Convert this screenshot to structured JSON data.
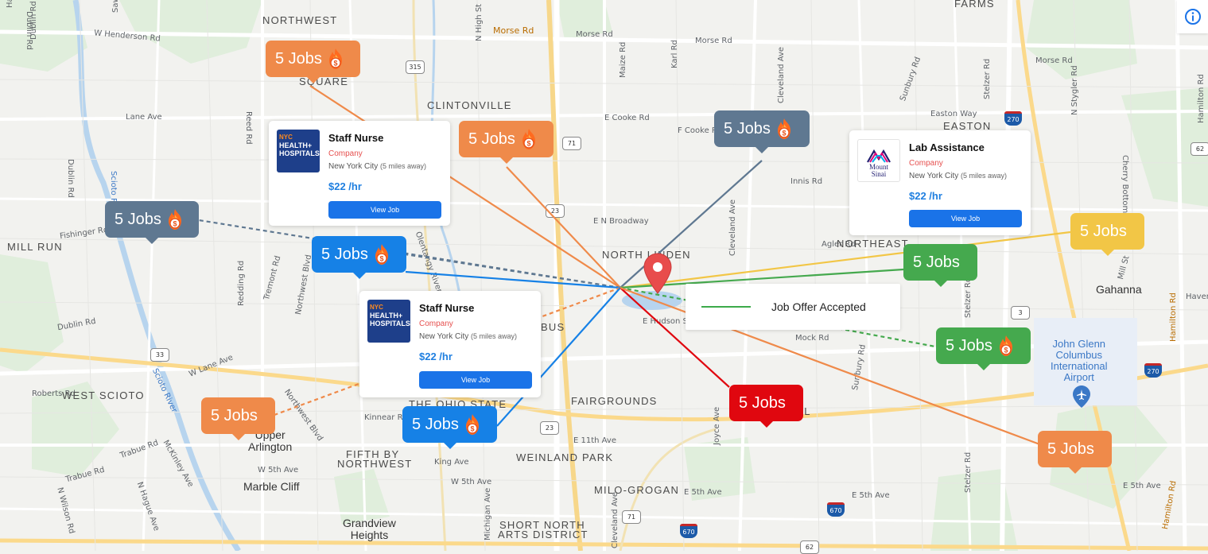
{
  "colors": {
    "orange": "#ef8a4a",
    "slate": "#5f7891",
    "blue": "#1681e6",
    "yellow": "#f2c646",
    "green": "#45a94e",
    "red": "#e0070f",
    "pin": "#e84c4c"
  },
  "bubble_text": "5 Jobs",
  "bubbles": [
    {
      "id": "b1",
      "text": "5 Jobs",
      "color": "orange",
      "fire": true
    },
    {
      "id": "b2",
      "text": "5 Jobs",
      "color": "orange",
      "fire": true
    },
    {
      "id": "b3",
      "text": "5 Jobs",
      "color": "slate",
      "fire": true
    },
    {
      "id": "b4",
      "text": "5 Jobs",
      "color": "slate",
      "fire": true
    },
    {
      "id": "b5",
      "text": "5 Jobs",
      "color": "blue",
      "fire": true
    },
    {
      "id": "b6",
      "text": "5 Jobs",
      "color": "yellow",
      "fire": false
    },
    {
      "id": "b7",
      "text": "5 Jobs",
      "color": "green",
      "fire": false
    },
    {
      "id": "b8",
      "text": "5 Jobs",
      "color": "green",
      "fire": true
    },
    {
      "id": "b9",
      "text": "5 Jobs",
      "color": "orange",
      "fire": false
    },
    {
      "id": "b10",
      "text": "5 Jobs",
      "color": "blue",
      "fire": true
    },
    {
      "id": "b11",
      "text": "5 Jobs",
      "color": "red",
      "fire": false
    },
    {
      "id": "b12",
      "text": "5 Jobs",
      "color": "orange",
      "fire": false
    }
  ],
  "cards": [
    {
      "title": "Staff Nurse",
      "company": "Company",
      "location": "New York City",
      "distance": "(5 miles away)",
      "rate": "$22 /hr",
      "button": "View Job",
      "logo_line1": "NYC",
      "logo_line2": "HEALTH+",
      "logo_line3": "HOSPITALS",
      "logo": "nyc-health-hospitals"
    },
    {
      "title": "Staff Nurse",
      "company": "Company",
      "location": "New York City",
      "distance": "(5 miles away)",
      "rate": "$22 /hr",
      "button": "View Job",
      "logo_line1": "NYC",
      "logo_line2": "HEALTH+",
      "logo_line3": "HOSPITALS",
      "logo": "nyc-health-hospitals"
    },
    {
      "title": "Lab Assistance",
      "company": "Company",
      "location": "New York City",
      "distance": "(5 miles away)",
      "rate": "$22 /hr",
      "button": "View Job",
      "logo_line1": "Mount",
      "logo_line2": "Sinai",
      "logo": "mount-sinai"
    }
  ],
  "legend": {
    "label": "Job Offer Accepted",
    "line_color": "#3daa4a"
  },
  "map_labels": {
    "areas": [
      "NORTHWEST",
      "CLINTONVILLE",
      "EASTON",
      "NORTHEAST",
      "FARMS",
      "MILL RUN",
      "NORTH LINDEN",
      "WEST SCIOTO",
      "FAIRGROUNDS",
      "THE OHIO STATE",
      "FIFTH BY",
      "NORTHWEST",
      "WEINLAND PARK",
      "MILO-GROGAN",
      "SHORT NORTH",
      "ARTS DISTRICT",
      "SQUARE",
      "BUS",
      "NIAL"
    ],
    "cities": [
      "Gahanna",
      "Upper",
      "Arlington",
      "Marble Cliff",
      "Grandview",
      "Heights"
    ],
    "airport": [
      "John Glenn",
      "Columbus",
      "International",
      "Airport"
    ],
    "roads": [
      "Dublin Rd",
      "W Henderson Rd",
      "Morse Rd",
      "Morse Rd",
      "Morse Rd",
      "Morse Rd",
      "Lane Ave",
      "Reed Rd",
      "N High St",
      "Maize Rd",
      "Karl Rd",
      "Cleveland Ave",
      "Sunbury Rd",
      "Stelzer Rd",
      "N Stygler Rd",
      "Hamilton Rd",
      "E Cooke Rd",
      "F Cooke Rd",
      "Easton Way",
      "Innis Rd",
      "Dublin Rd",
      "Scioto River",
      "Fishinger Rd",
      "E N Broadway",
      "Cleveland Ave",
      "Agler Rd",
      "Cherry Bottom Rd",
      "Mill St",
      "Havens",
      "Redding Rd",
      "Tremont Rd",
      "Northwest Blvd",
      "Olentangy River Rd",
      "E Hudson St",
      "Mock Rd",
      "Dublin Rd",
      "W Lane Ave",
      "Roberts Rd",
      "Scioto River",
      "Northwest Blvd",
      "Kinnear Rd",
      "E 11th Ave",
      "Joyce Ave",
      "Sunbury Rd",
      "Stelzer Rd",
      "Hamilton Rd",
      "Trabue Rd",
      "W 5th Ave",
      "Trabue Rd",
      "McKinley Ave",
      "N Hague Ave",
      "N Wilson Rd",
      "King Ave",
      "W 5th Ave",
      "Michigan Ave",
      "E 5th Ave",
      "E 5th Ave",
      "Cleveland Ave",
      "E 5th Ave",
      "Hamilton Rd",
      "Stelzer Rd",
      "Hayden Rd",
      "Sawmill Rd",
      "Dublin Rd"
    ],
    "shields": [
      "315",
      "71",
      "23",
      "270",
      "62",
      "33",
      "670",
      "670",
      "62",
      "270",
      "71",
      "23",
      "3"
    ]
  }
}
